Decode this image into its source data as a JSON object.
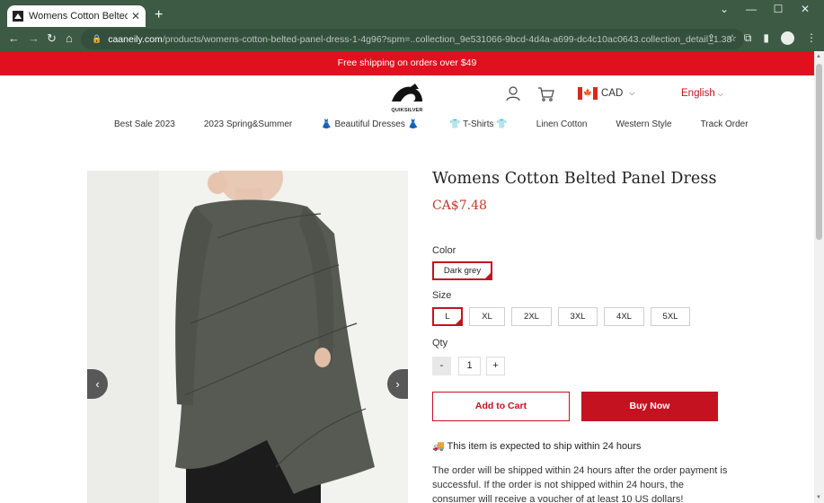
{
  "browser": {
    "tab_title": "Womens Cotton Belted Panel Dre",
    "url_host": "caaneily.com",
    "url_rest": "/products/womens-cotton-belted-panel-dress-1-4g96?spm=..collection_9e531066-9bcd-4d4a-a699-dc4c10ac0643.collection_detail_1.38"
  },
  "promo_text": "Free shipping on orders over $49",
  "header": {
    "logo_text": "QUIKSILVER",
    "currency": "CAD",
    "language": "English"
  },
  "nav": [
    "Best Sale 2023",
    "2023 Spring&Summer",
    "👗 Beautiful Dresses 👗",
    "👕 T-Shirts 👕",
    "Linen Cotton",
    "Western Style",
    "Track Order"
  ],
  "product": {
    "title": "Womens Cotton Belted Panel Dress",
    "price": "CA$7.48",
    "color_label": "Color",
    "color_selected": "Dark grey",
    "size_label": "Size",
    "sizes": [
      "L",
      "XL",
      "2XL",
      "3XL",
      "4XL",
      "5XL"
    ],
    "size_selected": "L",
    "qty_label": "Qty",
    "qty_minus": "-",
    "qty_value": "1",
    "qty_plus": "+",
    "add_to_cart": "Add to Cart",
    "buy_now": "Buy Now",
    "ship_notice": "🚚 This item is expected to ship within 24 hours",
    "ship_detail": "The order will be shipped within 24 hours after the order payment is successful. If the order is not shipped within 24 hours, the consumer will receive a voucher of at least 10 US dollars!"
  },
  "colors": {
    "brand_red": "#c41220",
    "promo_red": "#e0101e",
    "chrome_green": "#3d5a45",
    "dress_grey": "#575a52"
  }
}
